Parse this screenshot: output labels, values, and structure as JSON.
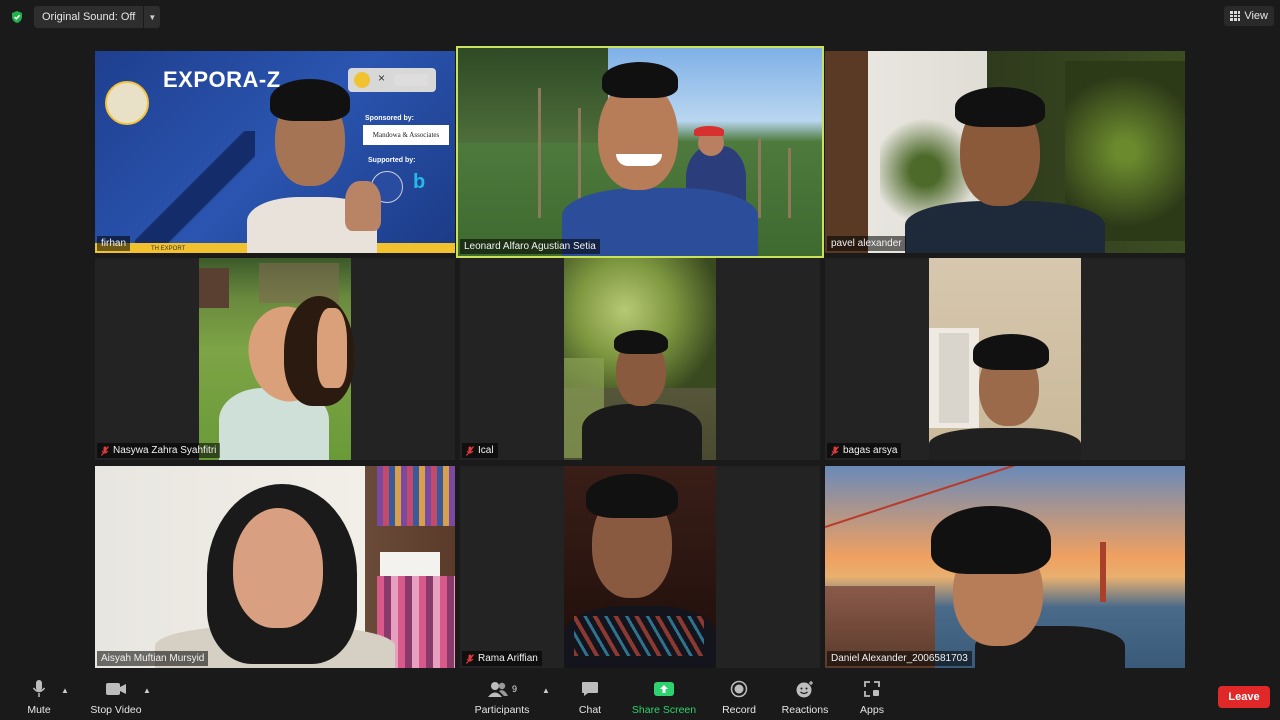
{
  "top": {
    "original_sound_label": "Original Sound: Off",
    "view_label": "View"
  },
  "participants": [
    {
      "name": "firhan",
      "muted": false,
      "active": false
    },
    {
      "name": "Leonard Alfaro Agustian Setia",
      "muted": false,
      "active": true
    },
    {
      "name": "pavel alexander",
      "muted": false,
      "active": false
    },
    {
      "name": "Nasywa Zahra Syahfitri",
      "muted": true,
      "active": false
    },
    {
      "name": "Ical",
      "muted": true,
      "active": false
    },
    {
      "name": "bagas arsya",
      "muted": true,
      "active": false
    },
    {
      "name": "Aisyah Muftian Mursyid",
      "muted": false,
      "active": false
    },
    {
      "name": "Rama Ariffian",
      "muted": true,
      "active": false
    },
    {
      "name": "Daniel Alexander_2006581703",
      "muted": false,
      "active": false
    }
  ],
  "background_text": {
    "title": "EXPORA-Z",
    "sponsored_by": "Sponsored by:",
    "sponsor_name": "Mandowa & Associates",
    "supported_by": "Supported by:",
    "bottom_strip": "TH EXPORT"
  },
  "toolbar": {
    "mute_label": "Mute",
    "stop_video_label": "Stop Video",
    "participants_label": "Participants",
    "participants_count": "9",
    "chat_label": "Chat",
    "share_screen_label": "Share Screen",
    "record_label": "Record",
    "reactions_label": "Reactions",
    "apps_label": "Apps",
    "leave_label": "Leave"
  },
  "colors": {
    "active_speaker": "#c8e35a",
    "share_green": "#2ed36f",
    "leave_red": "#e02828",
    "muted_red": "#e23b3b"
  }
}
